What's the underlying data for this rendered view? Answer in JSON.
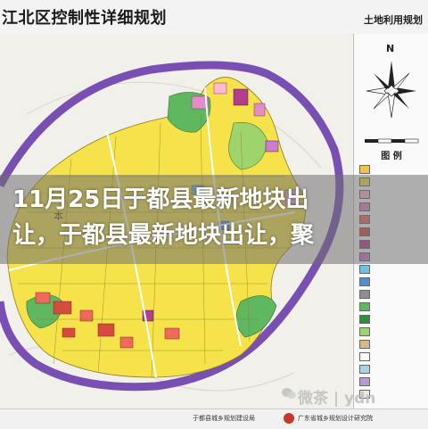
{
  "header": {
    "title": "江北区控制性详细规划",
    "right_title": "土地利用规划"
  },
  "overlay": {
    "headline": "11月25日于都县最新地块出\n让，于都县最新地块出让，聚"
  },
  "side_panel": {
    "compass_letter": "N",
    "legend_title": "图  例"
  },
  "legend": [
    {
      "color": "#f2c14e",
      "label": ""
    },
    {
      "color": "#f6e34b",
      "label": ""
    },
    {
      "color": "#ffb7d2",
      "label": ""
    },
    {
      "color": "#e58bc7",
      "label": ""
    },
    {
      "color": "#ef6a5b",
      "label": ""
    },
    {
      "color": "#d64a3f",
      "label": ""
    },
    {
      "color": "#b13d8c",
      "label": ""
    },
    {
      "color": "#c97dd3",
      "label": ""
    },
    {
      "color": "#6ec1e4",
      "label": ""
    },
    {
      "color": "#4f8fd1",
      "label": ""
    },
    {
      "color": "#8e8e8e",
      "label": ""
    },
    {
      "color": "#5fb85f",
      "label": ""
    },
    {
      "color": "#2f8f3f",
      "label": ""
    },
    {
      "color": "#9fd36b",
      "label": ""
    },
    {
      "color": "#d7b98a",
      "label": ""
    },
    {
      "color": "#ffffff",
      "label": ""
    },
    {
      "color": "#aad3e0",
      "label": ""
    },
    {
      "color": "#b59ad4",
      "label": ""
    },
    {
      "color": "#e9e9e9",
      "label": ""
    }
  ],
  "footer": {
    "left": "于都县城乡规划建设局",
    "right": "广东省城乡规划设计研究院"
  },
  "watermark": "微茶 | ydn",
  "colors": {
    "river": "#7a4fb3",
    "residential": "#f6e34b",
    "commercial": "#ef6a5b",
    "green": "#5fb85f",
    "public": "#e58bc7",
    "water": "#aad3e0"
  }
}
